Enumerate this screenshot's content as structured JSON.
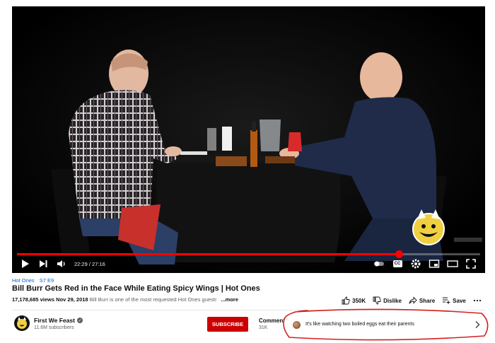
{
  "player": {
    "current_time": "22:29",
    "duration": "27:16",
    "time_display": "22:29 / 27:16",
    "progress_fraction": 0.824,
    "cc_label": "CC",
    "watermark_label": "FIRST WE FEAST"
  },
  "video": {
    "hashtags": [
      "Hot Ones",
      "S7 E9"
    ],
    "title": "Bill Burr Gets Red in the Face While Eating Spicy Wings | Hot Ones",
    "views": "17,178,685 views",
    "date": "Nov 29, 2018",
    "description_snippet": "Bill Burr is one of the most requested Hot Ones guests of",
    "more_label": "...more"
  },
  "actions": {
    "like_count": "350K",
    "dislike_label": "Dislike",
    "share_label": "Share",
    "save_label": "Save"
  },
  "channel": {
    "name": "First We Feast",
    "subscribers": "11.6M subscribers",
    "subscribe_label": "SUBSCRIBE"
  },
  "comments": {
    "label": "Comments",
    "count": "31K",
    "teaser_text": "It's like watching two boiled eggs eat their parents"
  },
  "colors": {
    "accent_red": "#ff0000",
    "subscribe_red": "#cc0000",
    "link_blue": "#065fd4",
    "annotation_red": "#d42020"
  }
}
